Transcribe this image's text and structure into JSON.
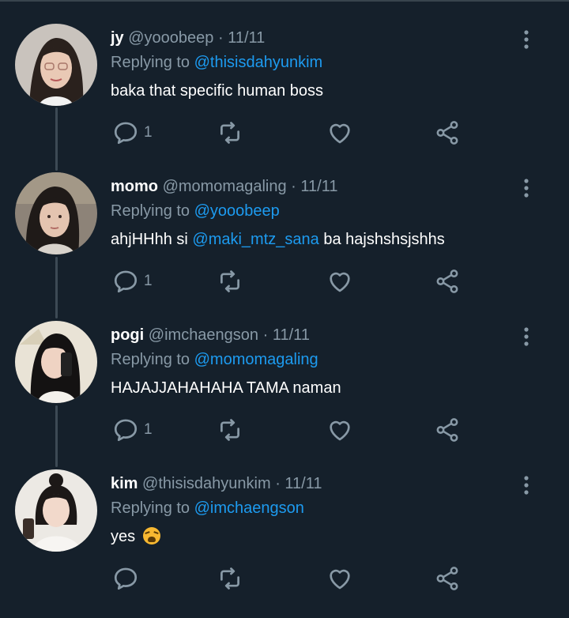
{
  "colors": {
    "background": "#15202b",
    "text": "#ffffff",
    "muted": "#8899a6",
    "link": "#1d9bf0"
  },
  "tweets": [
    {
      "name": "jy",
      "handle": "@yooobeep",
      "separator": "·",
      "date": "11/11",
      "replying_prefix": "Replying to",
      "replying_to": "@thisisdahyunkim",
      "text": "baka that specific human boss",
      "reply_count": "1",
      "avatar_icon": "avatar-photo"
    },
    {
      "name": "momo",
      "handle": "@momomagaling",
      "separator": "·",
      "date": "11/11",
      "replying_prefix": "Replying to",
      "replying_to": "@yooobeep",
      "text_pre": "ahjHHhh si",
      "text_mention": "@maki_mtz_sana",
      "text_post": "ba hajshshsjshhs",
      "reply_count": "1",
      "avatar_icon": "avatar-photo"
    },
    {
      "name": "pogi",
      "handle": "@imchaengson",
      "separator": "·",
      "date": "11/11",
      "replying_prefix": "Replying to",
      "replying_to": "@momomagaling",
      "text": "HAJAJJAHAHAHA TAMA naman",
      "reply_count": "1",
      "avatar_icon": "avatar-photo"
    },
    {
      "name": "kim",
      "handle": "@thisisdahyunkim",
      "separator": "·",
      "date": "11/11",
      "replying_prefix": "Replying to",
      "replying_to": "@imchaengson",
      "text": "yes",
      "emoji": "weary-face-emoji",
      "reply_count": "",
      "avatar_icon": "avatar-photo"
    }
  ],
  "action_icons": [
    "reply-icon",
    "retweet-icon",
    "like-icon",
    "share-icon"
  ],
  "menu_icon": "more-options-icon"
}
